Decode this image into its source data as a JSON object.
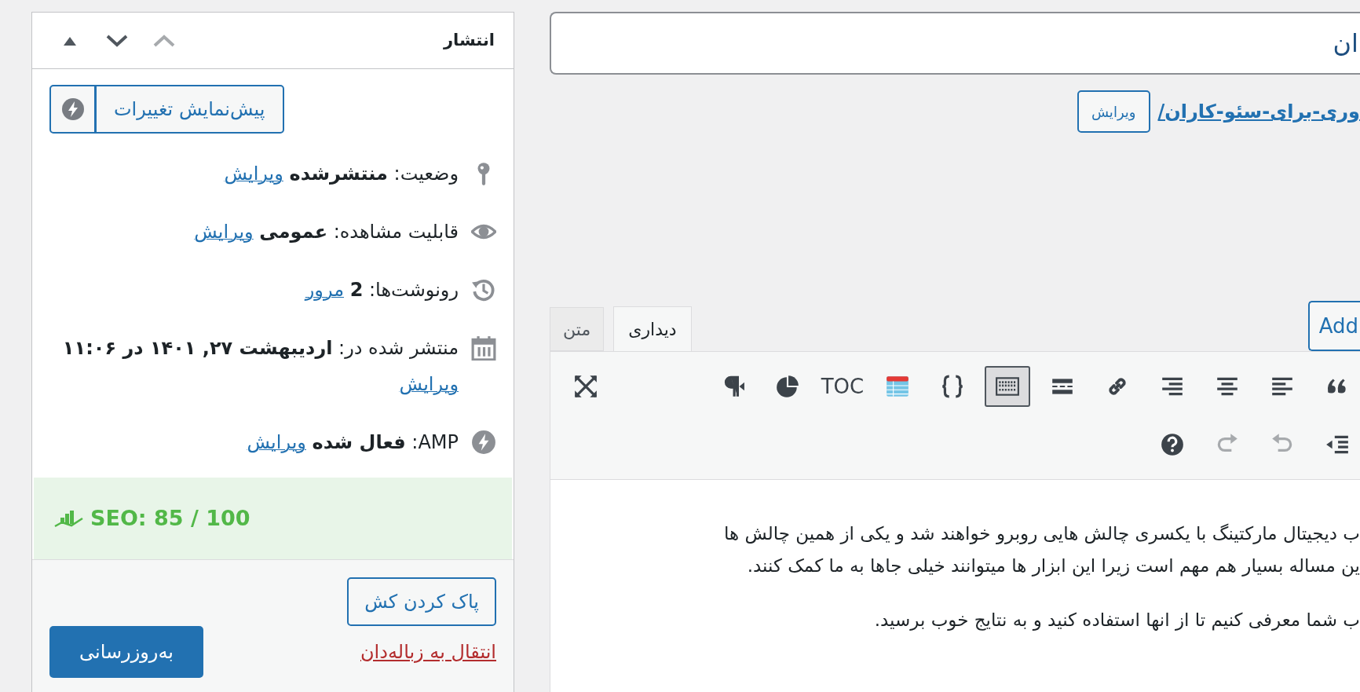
{
  "publish_box": {
    "title": "انتشار",
    "header_controls": [
      {
        "kind": "chevron-up",
        "disabled": true
      },
      {
        "kind": "chevron-down",
        "disabled": false
      },
      {
        "kind": "triangle-up",
        "disabled": false
      }
    ],
    "preview_button": "پیش‌نمایش تغییرات",
    "rows": [
      {
        "kind": "pin",
        "text": "وضعیت: **منتشرشده**",
        "link": "ویرایش"
      },
      {
        "kind": "eye",
        "text": "قابلیت مشاهده: **عمومی**",
        "link": "ویرایش"
      },
      {
        "kind": "history",
        "text": "رونوشت‌ها: **2**",
        "link": "مرور"
      },
      {
        "kind": "calendar",
        "text": "منتشر شده در: **اردیبهشت ۲۷, ۱۴۰۱ در ۱۱:۰۶**",
        "link": "ویرایش"
      },
      {
        "kind": "bolt",
        "text": "AMP: **فعال شده**",
        "link": "ویرایش"
      }
    ],
    "seo_score": "SEO: 85 / 100",
    "purge_cache_button": "پاک کردن کش",
    "trash_link": "انتقال به زباله‌دان",
    "update_button": "به‌روزرسانی"
  },
  "editor": {
    "title_value": "ان",
    "permalink": "وری-برای-سئو-کاران/",
    "permalink_edit_button": "ویرایش",
    "add_button": "Add",
    "tabs": [
      {
        "label": "دیداری",
        "selected": true
      },
      {
        "label": "متن",
        "selected": false
      }
    ],
    "toolbar_row_1": [
      {
        "kind": "quote",
        "pressed": false
      },
      {
        "kind": "align-left",
        "pressed": false
      },
      {
        "kind": "align-center",
        "pressed": false
      },
      {
        "kind": "align-right",
        "pressed": false
      },
      {
        "kind": "link",
        "pressed": false
      },
      {
        "kind": "more",
        "pressed": false
      },
      {
        "kind": "keyboard",
        "pressed": true
      },
      {
        "kind": "braces",
        "pressed": false
      },
      {
        "kind": "table",
        "pressed": false
      },
      {
        "kind": "text",
        "label": "TOC",
        "pressed": false
      },
      {
        "kind": "pie",
        "pressed": false
      },
      {
        "kind": "pilcrow",
        "pressed": false
      }
    ],
    "toolbar_row_2": [
      {
        "kind": "outdent",
        "pressed": false,
        "disabled": false
      },
      {
        "kind": "undo",
        "pressed": false,
        "disabled": true
      },
      {
        "kind": "redo",
        "pressed": false,
        "disabled": true
      },
      {
        "kind": "help",
        "pressed": false,
        "disabled": false
      }
    ],
    "paragraphs": [
      [
        "ب دیجیتال مارکتینگ با یکسری چالش هایی روبرو خواهند شد و یکی از همین چالش ها",
        "ین مساله بسیار هم مهم است زیرا این ابزار ها میتوانند خیلی جاها به ما کمک کنند."
      ],
      [
        "ب شما معرفی کنیم تا از انها استفاده کنید و به نتایج خوب برسید."
      ]
    ]
  }
}
